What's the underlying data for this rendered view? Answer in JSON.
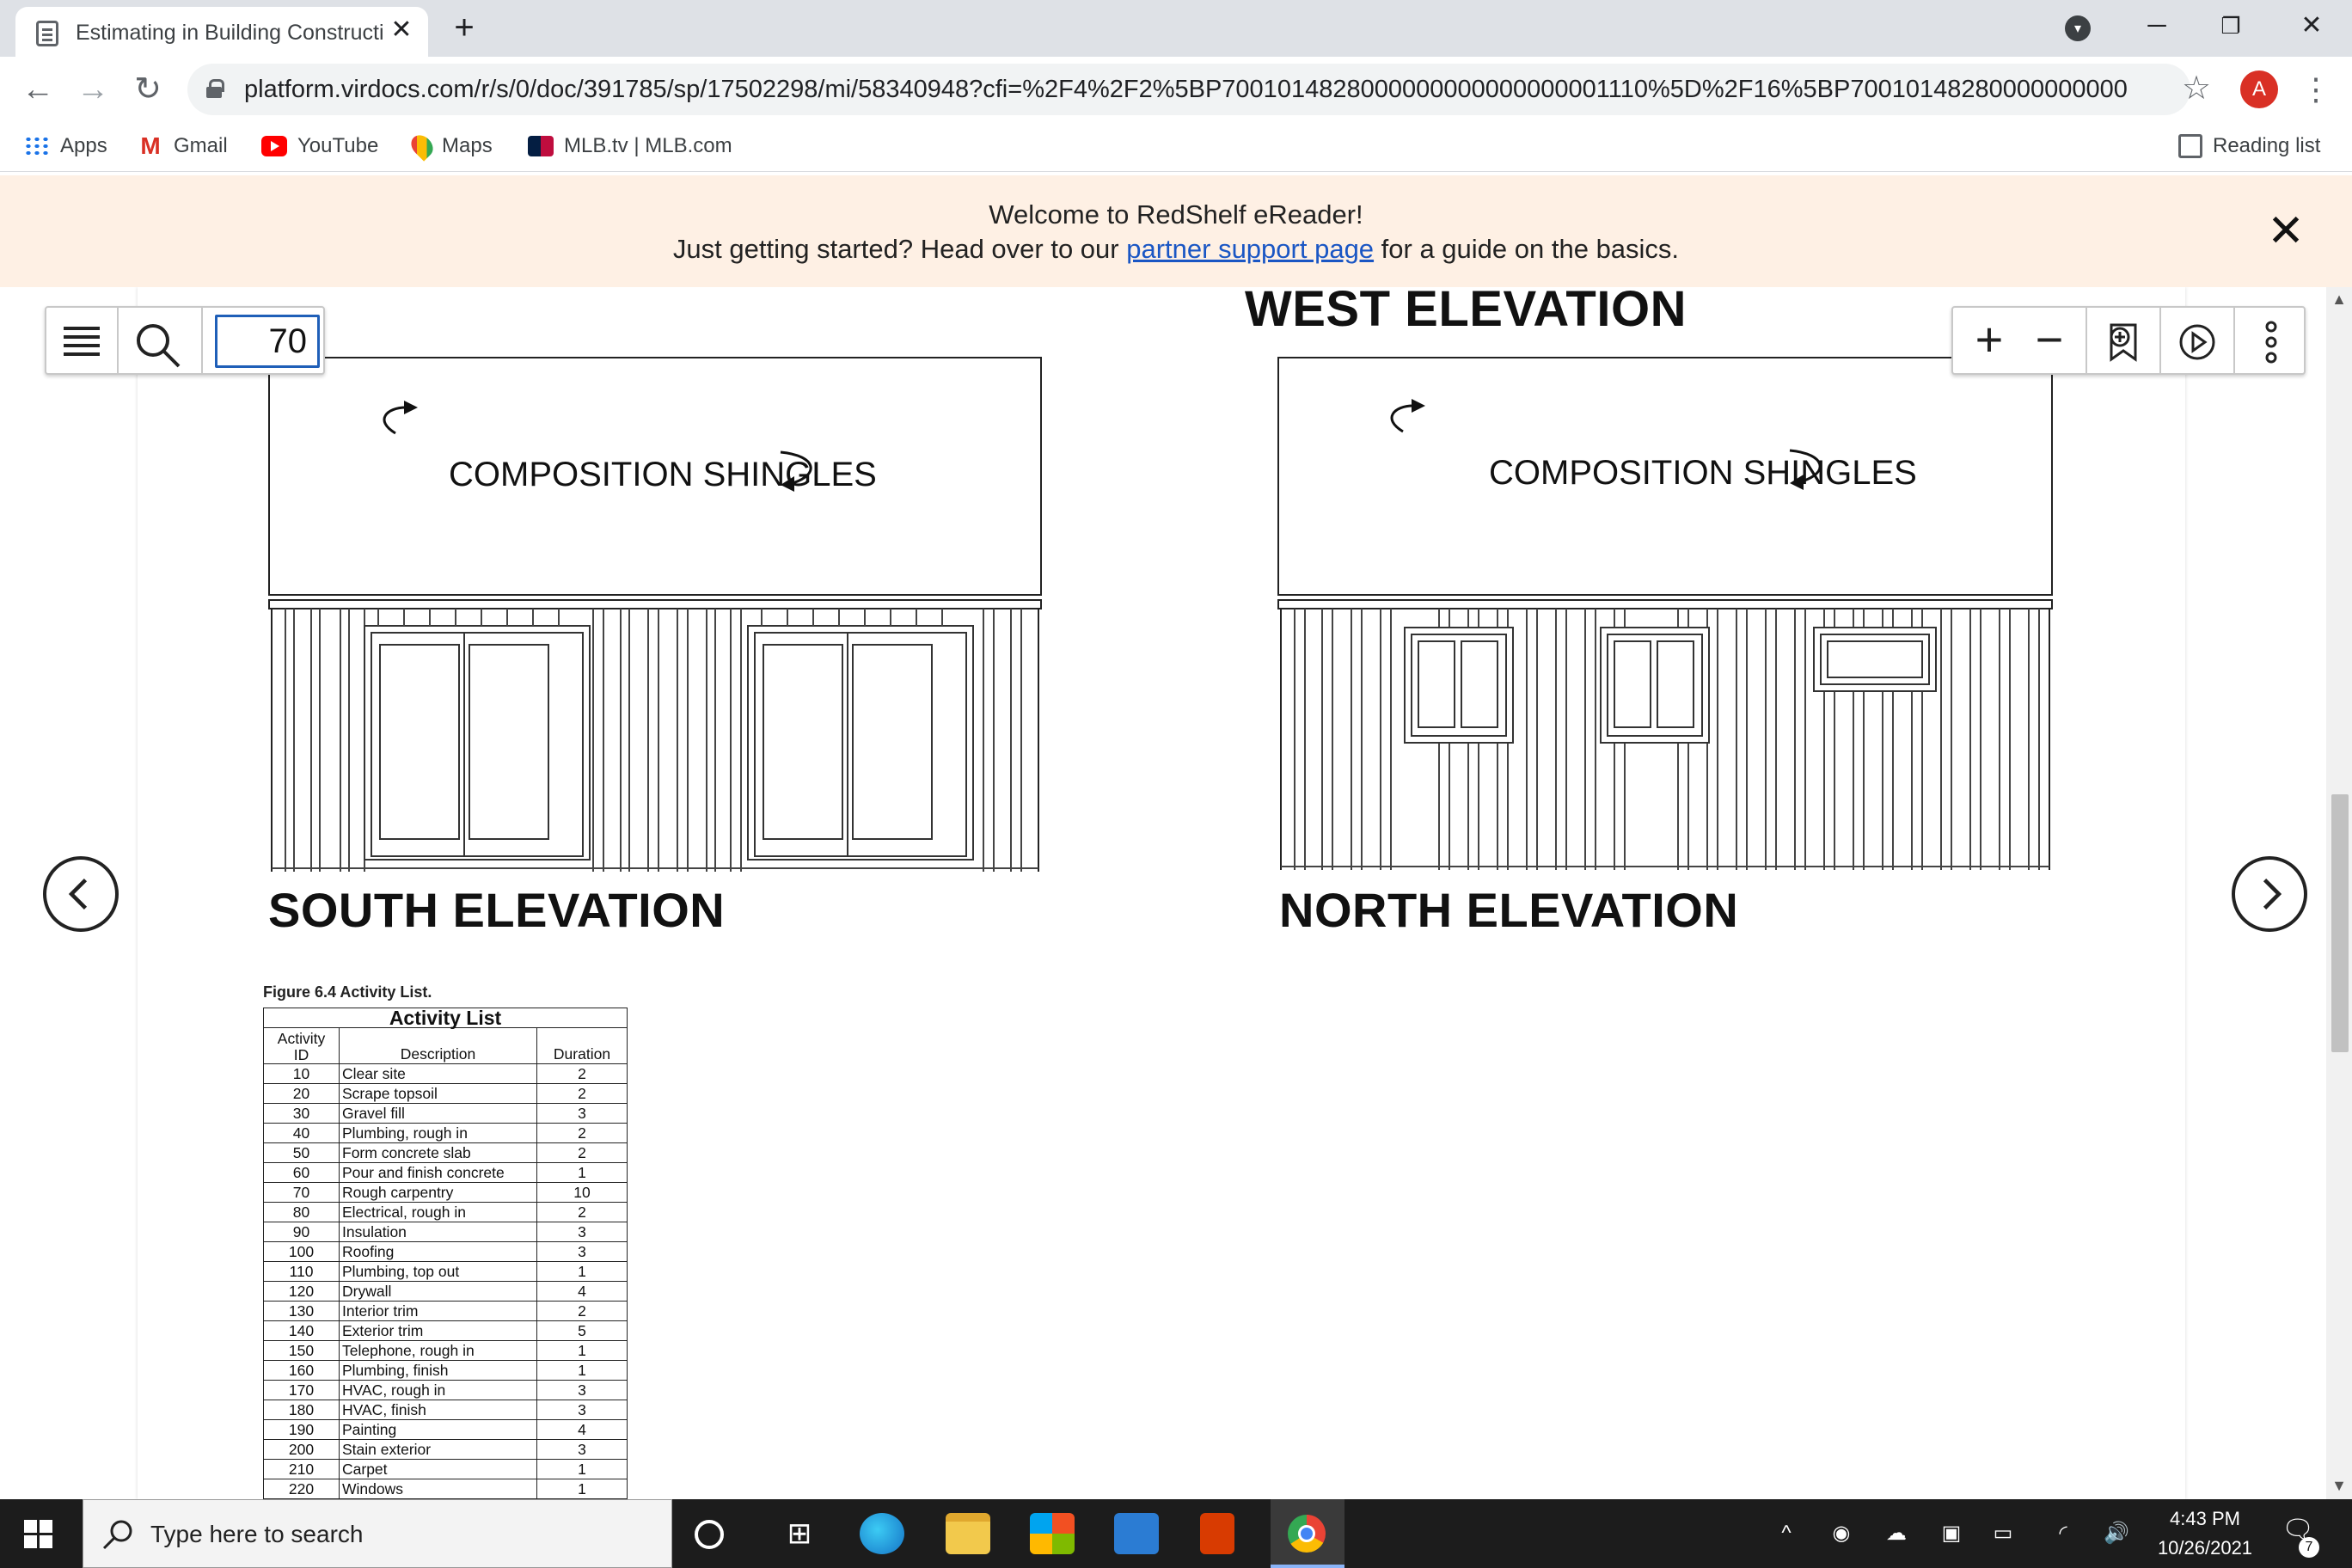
{
  "browser": {
    "tab_title": "Estimating in Building Constructi",
    "tab_close": "✕",
    "new_tab": "+",
    "url": "platform.virdocs.com/r/s/0/doc/391785/sp/17502298/mi/58340948?cfi=%2F4%2F2%5BP7001014828000000000000000001110%5D%2F16%5BP7001014828000000000000000001...",
    "profile_initial": "A",
    "bookmarks": [
      "Apps",
      "Gmail",
      "YouTube",
      "Maps",
      "MLB.tv | MLB.com"
    ],
    "reading_list": "Reading list"
  },
  "banner": {
    "line1": "Welcome to RedShelf eReader!",
    "line2_before": "Just getting started? Head over to our ",
    "line2_link": "partner support page",
    "line2_after": " for a guide on the basics.",
    "close": "✕"
  },
  "reader": {
    "page_number": "70",
    "west_title": "WEST ELEVATION",
    "south_title": "SOUTH ELEVATION",
    "north_title": "NORTH ELEVATION",
    "roof_label": "COMPOSITION SHINGLES",
    "figure_caption": "Figure 6.4 Activity List.",
    "table_title": "Activity List",
    "col_id": "Activity ID",
    "col_id_line1": "Activity",
    "col_id_line2": "ID",
    "col_desc": "Description",
    "col_dur": "Duration",
    "activities": [
      {
        "id": "10",
        "desc": "Clear site",
        "dur": "2"
      },
      {
        "id": "20",
        "desc": "Scrape topsoil",
        "dur": "2"
      },
      {
        "id": "30",
        "desc": "Gravel fill",
        "dur": "3"
      },
      {
        "id": "40",
        "desc": "Plumbing, rough in",
        "dur": "2"
      },
      {
        "id": "50",
        "desc": "Form concrete slab",
        "dur": "2"
      },
      {
        "id": "60",
        "desc": "Pour and finish concrete",
        "dur": "1"
      },
      {
        "id": "70",
        "desc": "Rough carpentry",
        "dur": "10"
      },
      {
        "id": "80",
        "desc": "Electrical, rough in",
        "dur": "2"
      },
      {
        "id": "90",
        "desc": "Insulation",
        "dur": "3"
      },
      {
        "id": "100",
        "desc": "Roofing",
        "dur": "3"
      },
      {
        "id": "110",
        "desc": "Plumbing, top out",
        "dur": "1"
      },
      {
        "id": "120",
        "desc": "Drywall",
        "dur": "4"
      },
      {
        "id": "130",
        "desc": "Interior trim",
        "dur": "2"
      },
      {
        "id": "140",
        "desc": "Exterior trim",
        "dur": "5"
      },
      {
        "id": "150",
        "desc": "Telephone, rough in",
        "dur": "1"
      },
      {
        "id": "160",
        "desc": "Plumbing, finish",
        "dur": "1"
      },
      {
        "id": "170",
        "desc": "HVAC, rough in",
        "dur": "3"
      },
      {
        "id": "180",
        "desc": "HVAC, finish",
        "dur": "3"
      },
      {
        "id": "190",
        "desc": "Painting",
        "dur": "4"
      },
      {
        "id": "200",
        "desc": "Stain exterior",
        "dur": "3"
      },
      {
        "id": "210",
        "desc": "Carpet",
        "dur": "1"
      },
      {
        "id": "220",
        "desc": "Windows",
        "dur": "1"
      }
    ]
  },
  "taskbar": {
    "search_placeholder": "Type here to search",
    "time": "4:43 PM",
    "date": "10/26/2021",
    "notification_count": "7"
  },
  "colors": {
    "banner_bg": "#fef0e4",
    "link": "#1a56c4",
    "page_input_border": "#1f5fb8",
    "taskbar_bg": "#1c1c1c"
  }
}
